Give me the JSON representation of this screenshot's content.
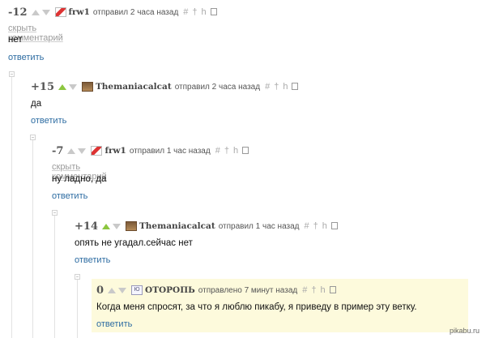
{
  "comments": [
    {
      "rating": "-12",
      "user": "frw1",
      "meta": "отправил 2 часа назад",
      "hide_label": "скрыть комментарий",
      "text": "нет",
      "reply_label": "ответить"
    },
    {
      "rating": "+15",
      "user": "Themaniacalcat",
      "meta": "отправил 2 часа назад",
      "text": "да",
      "reply_label": "ответить"
    },
    {
      "rating": "-7",
      "user": "frw1",
      "meta": "отправил 1 час назад",
      "hide_label": "скрыть комментарий",
      "text": "ну ладно, да",
      "reply_label": "ответить"
    },
    {
      "rating": "+14",
      "user": "Themaniacalcat",
      "meta": "отправил 1 час назад",
      "text": "опять не угадал.сейчас нет",
      "reply_label": "ответить"
    },
    {
      "rating": "0",
      "user": "ОТОРОПЬ",
      "meta": "отправлено 7 минут назад",
      "text": "Когда меня спросят, за что я люблю пикабу, я приведу в пример эту ветку.",
      "reply_label": "ответить"
    }
  ],
  "tools": {
    "hash": "#",
    "up": "†",
    "branch": "h"
  },
  "avatar_text": "Ю",
  "watermark": "pikabu.ru",
  "colors": {
    "link": "#2d6ca2",
    "upvote": "#8cc63f",
    "highlight": "#fdfadc"
  }
}
